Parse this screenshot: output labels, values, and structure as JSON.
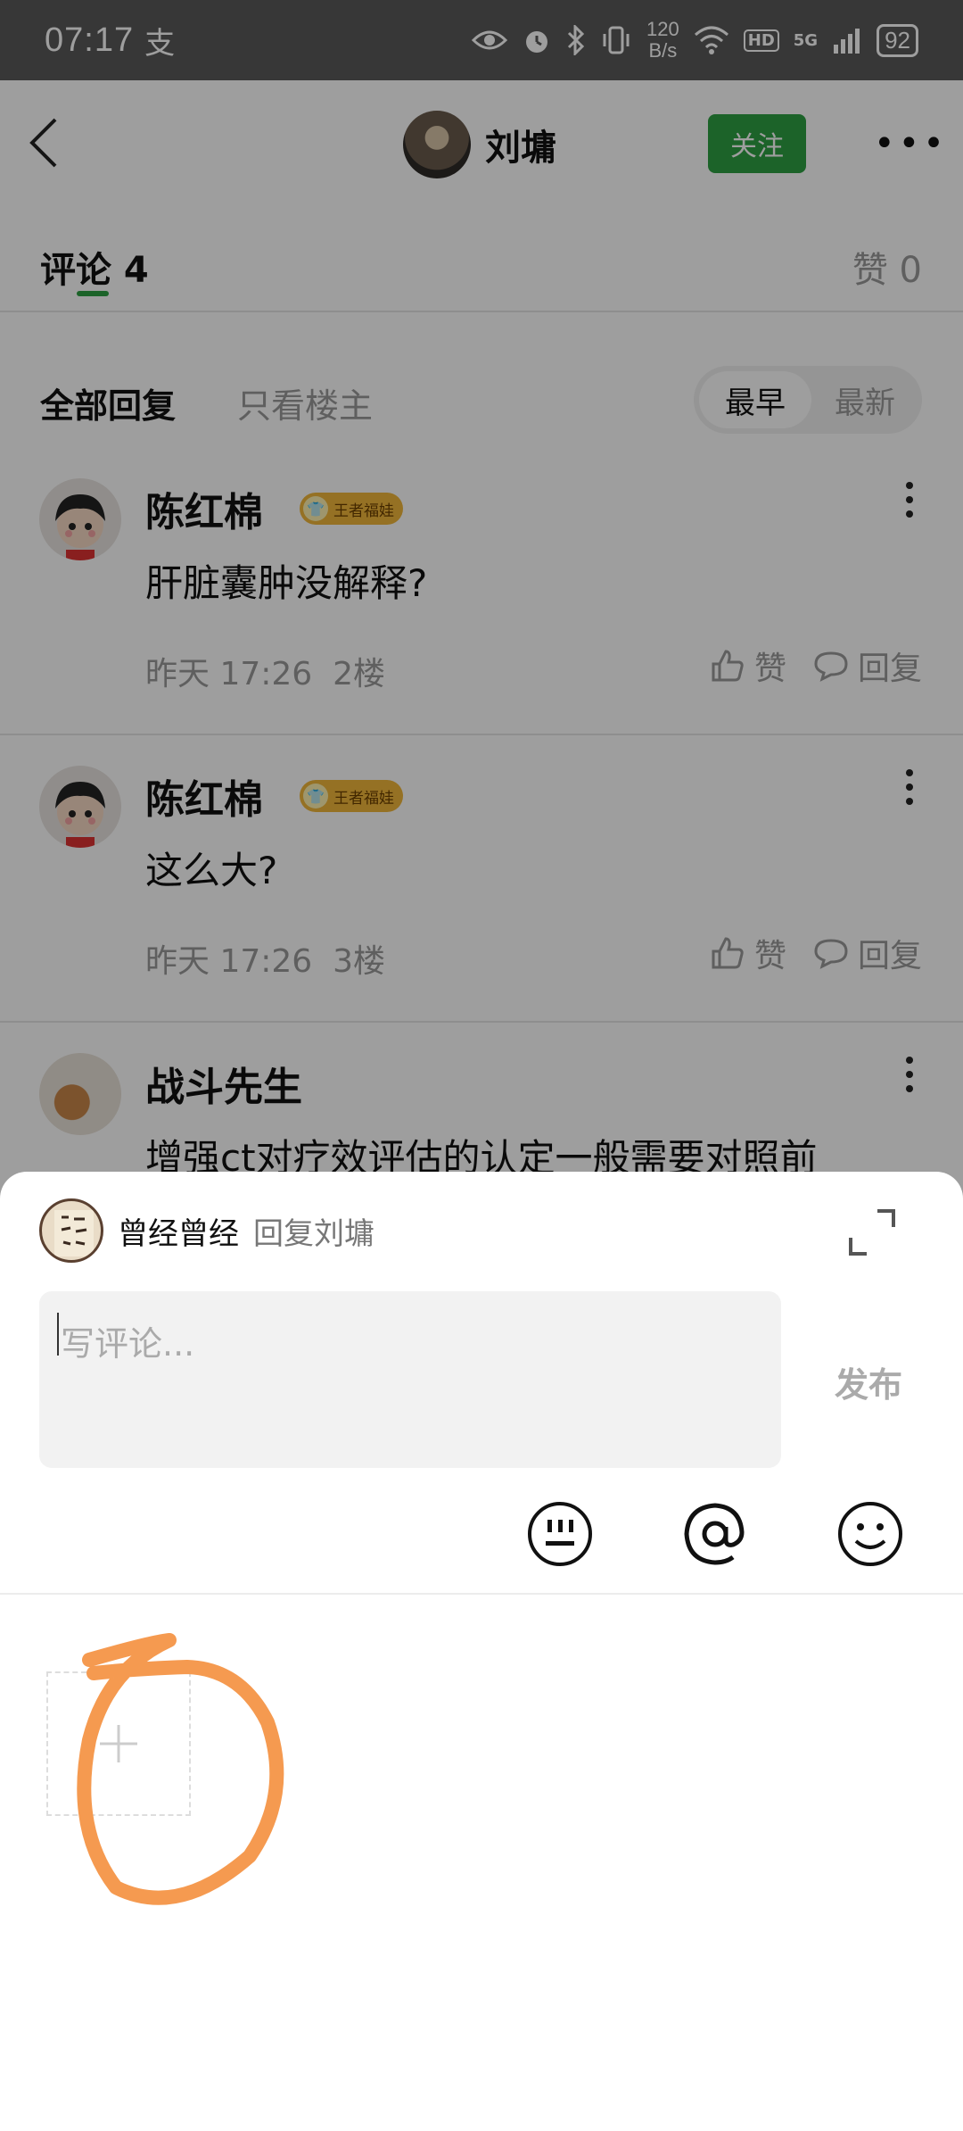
{
  "status_bar": {
    "time": "07:17",
    "net_speed_value": "120",
    "net_speed_unit": "B/s",
    "hd_label": "HD",
    "network_type": "5G",
    "battery": "92"
  },
  "header": {
    "author_name": "刘墉",
    "follow_label": "关注"
  },
  "tabs": {
    "comments_label": "评论 4",
    "likes_label": "赞 0"
  },
  "filters": {
    "all_label": "全部回复",
    "owner_label": "只看楼主",
    "sort_early": "最早",
    "sort_new": "最新"
  },
  "comments": [
    {
      "name": "陈红棉",
      "badge": "王者福娃",
      "text": "肝脏囊肿没解释?",
      "time": "昨天 17:26",
      "floor": "2楼",
      "like_label": "赞",
      "reply_label": "回复"
    },
    {
      "name": "陈红棉",
      "badge": "王者福娃",
      "text": "这么大?",
      "time": "昨天 17:26",
      "floor": "3楼",
      "like_label": "赞",
      "reply_label": "回复"
    },
    {
      "name": "战斗先生",
      "text": "增强ct对疗效评估的认定一般需要对照前"
    }
  ],
  "composer": {
    "user_name": "曾经曾经",
    "reply_to": "回复刘墉",
    "placeholder": "写评论...",
    "publish_label": "发布"
  },
  "colors": {
    "accent_green": "#2ea043",
    "annotation_orange": "#f59a50",
    "badge_gold": "#f0b73a"
  }
}
